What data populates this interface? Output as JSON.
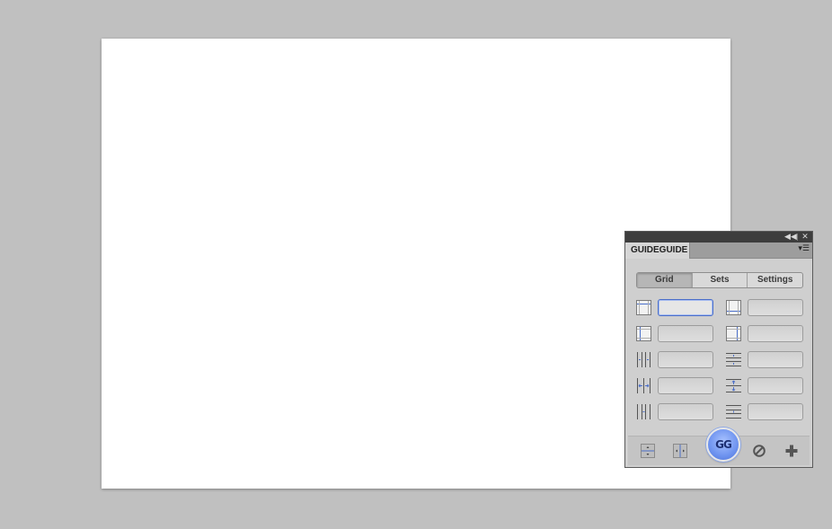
{
  "panel": {
    "title": "GUIDEGUIDE",
    "topbar": {
      "collapse_icon": "collapse-icon",
      "close_icon": "close-icon"
    },
    "menu_icon": "panel-menu-icon",
    "tabs": [
      {
        "label": "Grid",
        "active": true
      },
      {
        "label": "Sets",
        "active": false
      },
      {
        "label": "Settings",
        "active": false
      }
    ],
    "fields": {
      "margin_top": {
        "value": "",
        "placeholder": ""
      },
      "margin_bottom": {
        "value": "",
        "placeholder": ""
      },
      "margin_left": {
        "value": "",
        "placeholder": ""
      },
      "margin_right": {
        "value": "",
        "placeholder": ""
      },
      "columns": {
        "value": "",
        "placeholder": ""
      },
      "rows": {
        "value": "",
        "placeholder": ""
      },
      "column_width": {
        "value": "",
        "placeholder": ""
      },
      "row_height": {
        "value": "",
        "placeholder": ""
      },
      "column_gutter": {
        "value": "",
        "placeholder": ""
      },
      "row_gutter": {
        "value": "",
        "placeholder": ""
      }
    },
    "bottom": {
      "gg_label": "GG"
    },
    "colors": {
      "accent": "#4b6fc9",
      "panel_bg": "#cfcfcf",
      "topbar_bg": "#3d3d3d",
      "canvas_bg": "#c0c0c0"
    }
  }
}
